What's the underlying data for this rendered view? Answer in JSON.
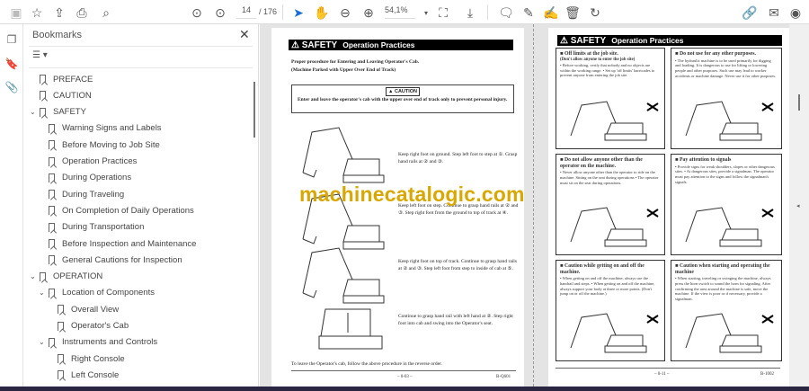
{
  "toolbar": {
    "page_current": "14",
    "page_total": "/ 176",
    "zoom": "54,1%"
  },
  "panel": {
    "title": "Bookmarks",
    "close": "✕"
  },
  "bookmarks": [
    {
      "label": "PREFACE",
      "level": 0,
      "expanded": null
    },
    {
      "label": "CAUTION",
      "level": 0,
      "expanded": null
    },
    {
      "label": "SAFETY",
      "level": 0,
      "expanded": true
    },
    {
      "label": "Warning Signs and Labels",
      "level": 1,
      "expanded": null
    },
    {
      "label": "Before Moving to Job Site",
      "level": 1,
      "expanded": null
    },
    {
      "label": "Operation Practices",
      "level": 1,
      "expanded": null
    },
    {
      "label": "During Operations",
      "level": 1,
      "expanded": null
    },
    {
      "label": "During Traveling",
      "level": 1,
      "expanded": null
    },
    {
      "label": "On Completion of Daily Operations",
      "level": 1,
      "expanded": null
    },
    {
      "label": "During Transportation",
      "level": 1,
      "expanded": null
    },
    {
      "label": "Before Inspection and Maintenance",
      "level": 1,
      "expanded": null
    },
    {
      "label": "General Cautions for Inspection",
      "level": 1,
      "expanded": null
    },
    {
      "label": "OPERATION",
      "level": 0,
      "expanded": true
    },
    {
      "label": "Location of Components",
      "level": 1,
      "expanded": true
    },
    {
      "label": "Overall View",
      "level": 2,
      "expanded": null
    },
    {
      "label": "Operator's Cab",
      "level": 2,
      "expanded": null
    },
    {
      "label": "Instruments and Controls",
      "level": 1,
      "expanded": true
    },
    {
      "label": "Right Console",
      "level": 2,
      "expanded": null
    },
    {
      "label": "Left Console",
      "level": 2,
      "expanded": null
    }
  ],
  "left_page": {
    "safety": "⚠ SAFETY",
    "header": "Operation Practices",
    "intro1": "Proper procedure for Entering and Leaving Operator's Cab.",
    "intro2": "(Machine Parked with Upper Over End of Track)",
    "caution_label": "▲ CAUTION",
    "caution_text": "Enter and leave the operator's cab with the upper over end of track only to prevent personal injury.",
    "steps": [
      "Keep right foot on ground. Step left foot to step at ①. Grasp hand rails at ② and ③.",
      "Keep left foot on step. Continue to grasp hand rails at ② and ③. Step right foot from the ground to top of track at ④.",
      "Keep right foot on top of track. Continue to grasp hand rails at ② and ③. Step left foot from step to inside of cab at ⑤.",
      "Continue to grasp hand rail with left hand at ②. Step right foot into cab and swing into the Operator's seat."
    ],
    "closing": "To leave the Operator's cab, follow the above procedure in the reverse order.",
    "page_no": "– 0-03 –",
    "code": "B-Q601"
  },
  "right_page": {
    "safety": "⚠ SAFETY",
    "header": "Operation Practices",
    "boxes": [
      {
        "title": "■ Off limits at the job site.",
        "subtitle": "(Don't allow anyone to enter the job site)",
        "text": "• Before working, verify that nobody and no objects are within the working range. • Set up 'off limits' barricades to prevent anyone from entering the job site."
      },
      {
        "title": "■ Do not use for any other purposes.",
        "subtitle": "",
        "text": "• The hydraulic machine is to be used primarily for digging and loading. It is dangerous to use for lifting or lowering people and other purposes. Such use may lead to worker accidents or machine damage. Never use it for other purposes."
      },
      {
        "title": "■ Do not allow anyone other than the operator on the machine.",
        "subtitle": "",
        "text": "• Never allow anyone other than the operator to ride on the machine. Sitting on the seat during operations • The operator must sit on the seat during operations."
      },
      {
        "title": "■ Pay attention to signals",
        "subtitle": "",
        "text": "• Provide signs for weak shoulders, slopes or other dangerous sites. • At dangerous sites, provide a signalman. The operator must pay attention to the signs and follow the signalman's signals."
      },
      {
        "title": "■ Caution while getting on and off the machine.",
        "subtitle": "",
        "text": "• When getting on and off the machine, always use the handrail and steps. • When getting on and off the machine, always support your body at three or more points. (Don't jump on or off the machine.)"
      },
      {
        "title": "■ Caution when starting and operating the machine",
        "subtitle": "",
        "text": "• When starting, traveling or swinging the machine, always press the horn switch to sound the horn for signaling. After confirming the area around the machine is safe, move the machine. If the view is poor or if necessary, provide a signalman."
      }
    ],
    "page_no": "– 0-11 –",
    "code": "B-1002"
  },
  "watermark": "machinecatalogic.com"
}
